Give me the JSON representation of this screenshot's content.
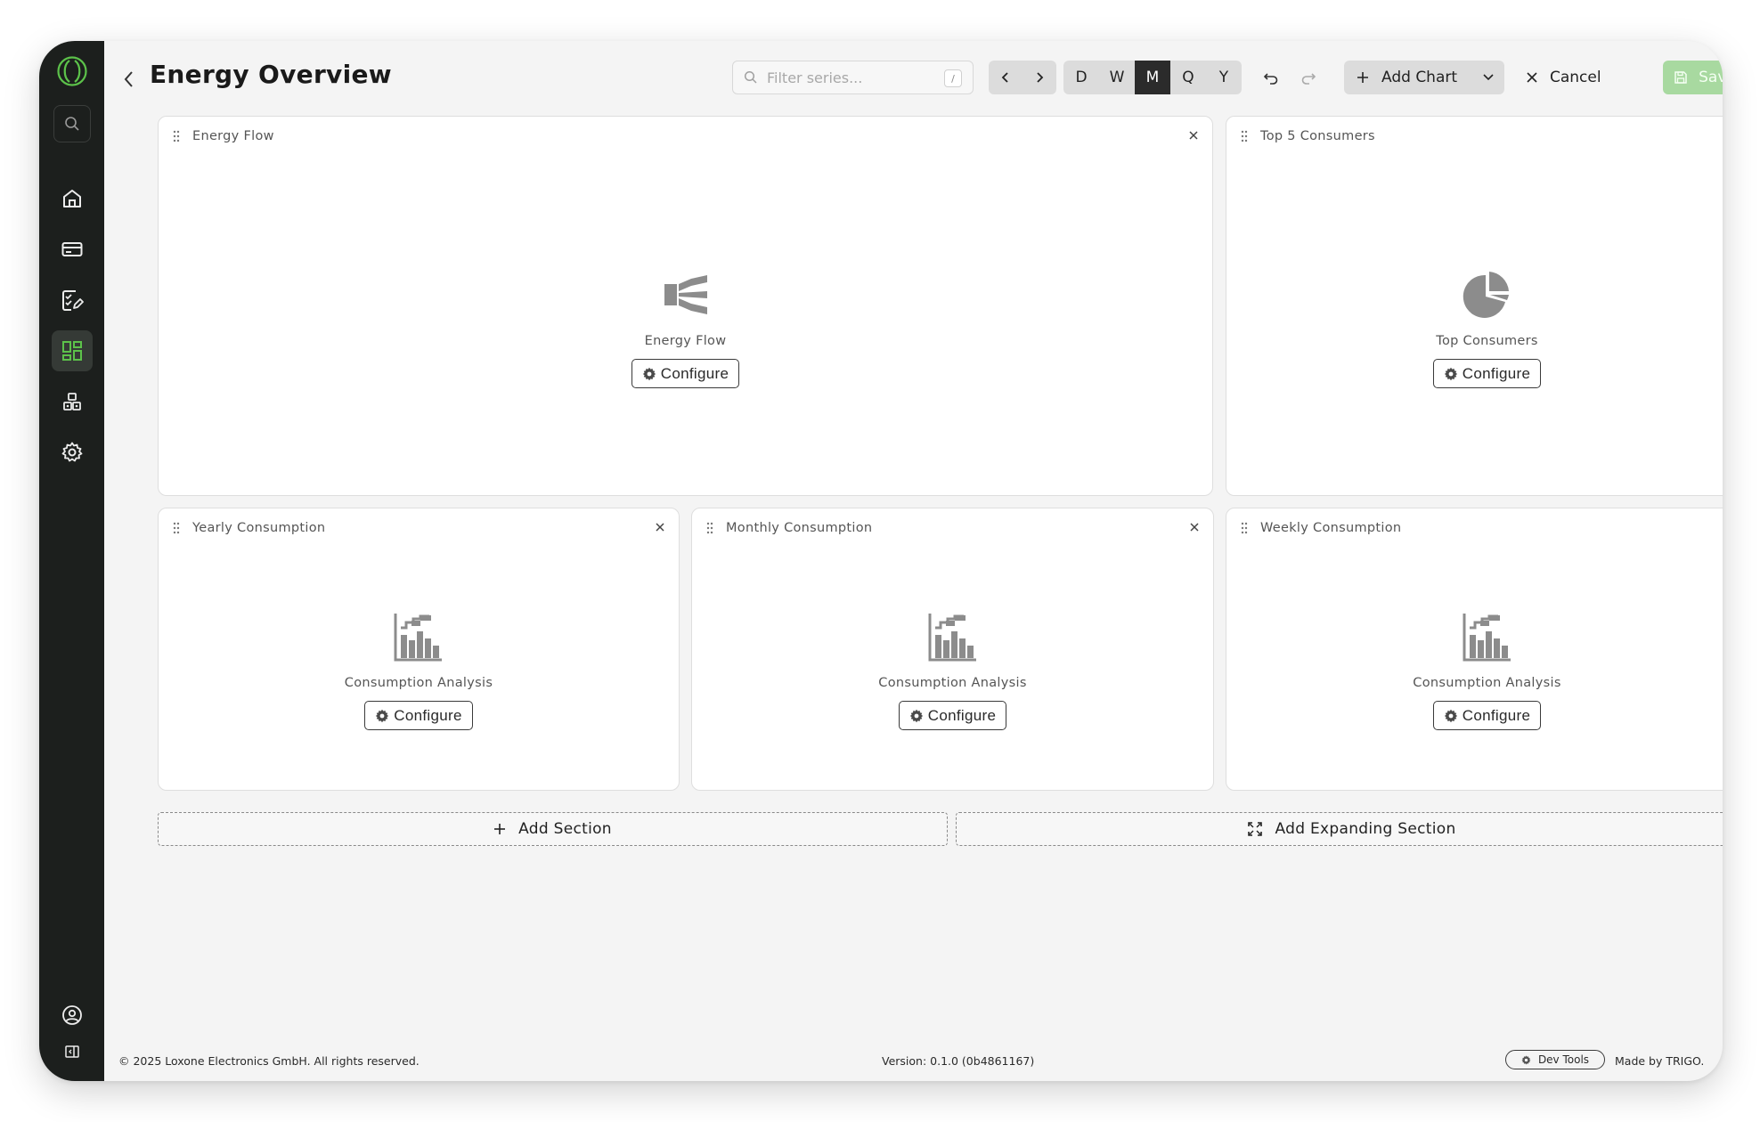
{
  "sidebar": {
    "logo": "loxone-logo-icon",
    "search_icon": "search-icon",
    "items": [
      {
        "name": "home",
        "icon": "home-icon",
        "active": false
      },
      {
        "name": "cards",
        "icon": "card-icon",
        "active": false
      },
      {
        "name": "tasks",
        "icon": "checklist-edit-icon",
        "active": false
      },
      {
        "name": "dashboards",
        "icon": "dashboard-icon",
        "active": true
      },
      {
        "name": "devices",
        "icon": "blocks-icon",
        "active": false
      },
      {
        "name": "settings",
        "icon": "gear-icon",
        "active": false
      }
    ],
    "bottom": [
      {
        "name": "account",
        "icon": "user-circle-icon"
      },
      {
        "name": "collapse",
        "icon": "collapse-sidebar-icon"
      }
    ]
  },
  "header": {
    "title": "Energy Overview",
    "filter_placeholder": "Filter series...",
    "filter_shortcut": "/",
    "periods": [
      "D",
      "W",
      "M",
      "Q",
      "Y"
    ],
    "selected_period": "M",
    "add_chart_label": "Add Chart",
    "cancel_label": "Cancel",
    "save_label": "Save"
  },
  "cards": [
    {
      "title": "Energy Flow",
      "chart_label": "Energy Flow",
      "icon": "energy-flow-icon",
      "button": "Configure"
    },
    {
      "title": "Top 5 Consumers",
      "chart_label": "Top Consumers",
      "icon": "pie-chart-icon",
      "button": "Configure"
    },
    {
      "title": "Yearly Consumption",
      "chart_label": "Consumption Analysis",
      "icon": "bar-chart-icon",
      "button": "Configure"
    },
    {
      "title": "Monthly Consumption",
      "chart_label": "Consumption Analysis",
      "icon": "bar-chart-icon",
      "button": "Configure"
    },
    {
      "title": "Weekly Consumption",
      "chart_label": "Consumption Analysis",
      "icon": "bar-chart-icon",
      "button": "Configure"
    }
  ],
  "sections": {
    "add_section": "Add Section",
    "add_expanding_section": "Add Expanding Section"
  },
  "footer": {
    "copyright": "© 2025 Loxone Electronics GmbH. All rights reserved.",
    "version": "Version: 0.1.0 (0b4861167)",
    "dev_tools": "Dev Tools",
    "made_by": "Made by TRIGO.",
    "language_icon": "uk-flag-icon"
  },
  "colors": {
    "sidebar_bg": "#1c1f1d",
    "accent_green": "#5cc24a",
    "save_disabled": "#a8d9a0",
    "selected_period_bg": "#2b2b2b"
  }
}
